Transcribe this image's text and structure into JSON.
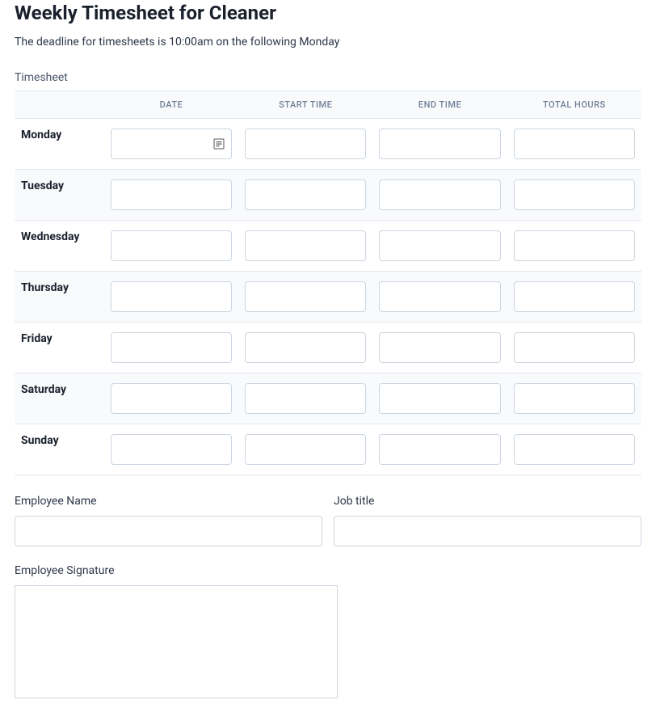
{
  "header": {
    "title": "Weekly Timesheet for Cleaner",
    "subtitle": "The deadline for timesheets is 10:00am on the following Monday"
  },
  "timesheet": {
    "label": "Timesheet",
    "columns": {
      "day": "",
      "date": "DATE",
      "start": "START TIME",
      "end": "END TIME",
      "total": "TOTAL HOURS"
    },
    "rows": [
      {
        "day": "Monday",
        "date": "",
        "start": "",
        "end": "",
        "total": "",
        "show_date_icon": true
      },
      {
        "day": "Tuesday",
        "date": "",
        "start": "",
        "end": "",
        "total": "",
        "show_date_icon": false
      },
      {
        "day": "Wednesday",
        "date": "",
        "start": "",
        "end": "",
        "total": "",
        "show_date_icon": false
      },
      {
        "day": "Thursday",
        "date": "",
        "start": "",
        "end": "",
        "total": "",
        "show_date_icon": false
      },
      {
        "day": "Friday",
        "date": "",
        "start": "",
        "end": "",
        "total": "",
        "show_date_icon": false
      },
      {
        "day": "Saturday",
        "date": "",
        "start": "",
        "end": "",
        "total": "",
        "show_date_icon": false
      },
      {
        "day": "Sunday",
        "date": "",
        "start": "",
        "end": "",
        "total": "",
        "show_date_icon": false
      }
    ]
  },
  "fields": {
    "employee_name": {
      "label": "Employee Name",
      "value": ""
    },
    "job_title": {
      "label": "Job title",
      "value": ""
    },
    "signature": {
      "label": "Employee Signature"
    }
  }
}
